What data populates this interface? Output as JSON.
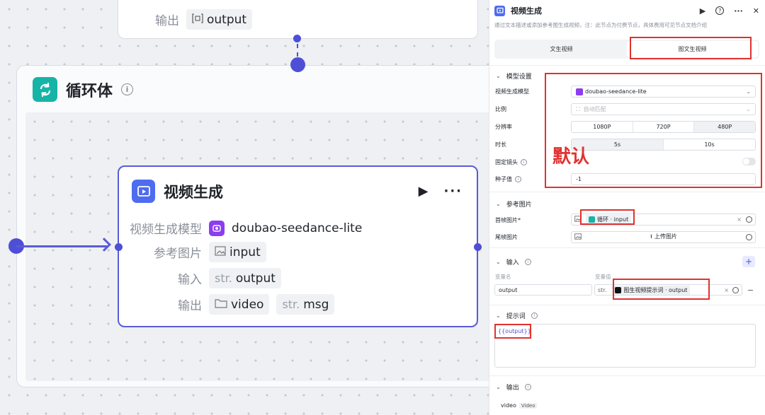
{
  "canvas": {
    "top_node": {
      "output_label": "输出",
      "output_value": "output"
    },
    "loop": {
      "title": "循环体"
    },
    "video_node": {
      "title": "视频生成",
      "model_label": "视频生成模型",
      "model_value": "doubao-seedance-lite",
      "ref_label": "参考图片",
      "ref_value": "input",
      "input_label": "输入",
      "input_prefix": "str.",
      "input_value": "output",
      "output_label": "输出",
      "output_value1": "video",
      "output_prefix": "str.",
      "output_value2": "msg"
    }
  },
  "panel": {
    "title": "视频生成",
    "description": "通过文本描述或添加参考图生成视频，注：此节点为付费节点，具体费用可见节点文档介绍",
    "tabs": [
      "文生视频",
      "图文生视频"
    ],
    "active_tab": "图文生视频",
    "model_section": {
      "title": "模型设置",
      "model_label": "视频生成模型",
      "model_value": "doubao-seedance-lite",
      "ratio_label": "比例",
      "ratio_placeholder": "自动匹配",
      "resolution_label": "分辨率",
      "resolution_options": [
        "1080P",
        "720P",
        "480P"
      ],
      "resolution_selected": "480P",
      "duration_label": "时长",
      "duration_options": [
        "5s",
        "10s"
      ],
      "duration_selected": "5s",
      "fixed_camera_label": "固定镜头",
      "seed_label": "种子值",
      "seed_value": "-1",
      "annotation": "默认"
    },
    "ref_section": {
      "title": "参考图片",
      "first_frame_label": "首帧图片*",
      "first_frame_value": "循环 · input",
      "last_frame_label": "尾帧图片",
      "upload_label": "上传图片"
    },
    "input_section": {
      "title": "输入",
      "var_name_label": "变量名",
      "var_value_label": "变量值",
      "var_name": "output",
      "var_type": "str.",
      "var_value": "图生视频提示词 · output"
    },
    "prompt_section": {
      "title": "提示词",
      "prompt_value": "{{output}}"
    },
    "output_section": {
      "title": "输出",
      "output_name": "video",
      "output_type": "Video"
    }
  }
}
